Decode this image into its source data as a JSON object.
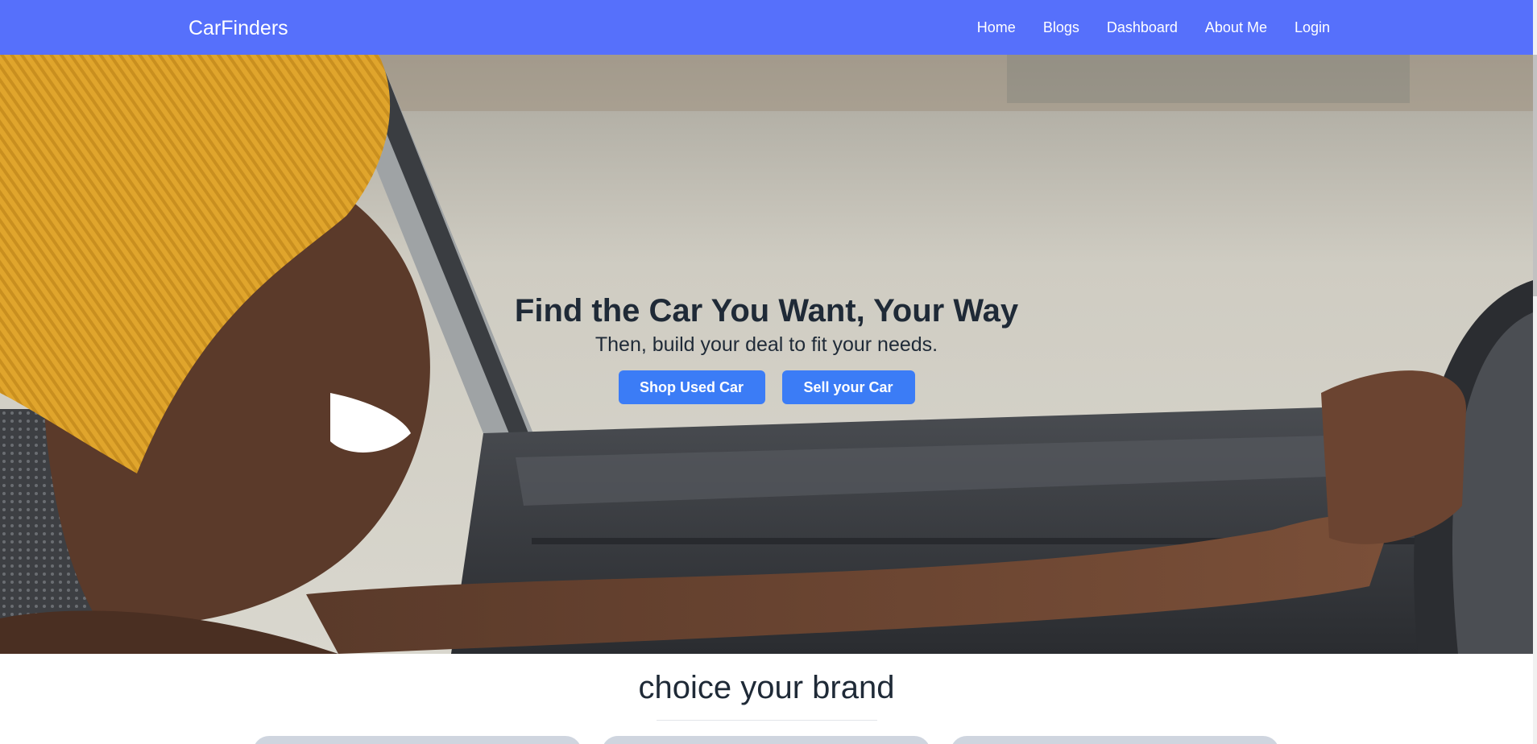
{
  "navbar": {
    "brand": "CarFinders",
    "links": [
      "Home",
      "Blogs",
      "Dashboard",
      "About Me",
      "Login"
    ]
  },
  "hero": {
    "title": "Find the Car You Want, Your Way",
    "subtitle": "Then, build your deal to fit your needs.",
    "buttons": {
      "shop": "Shop Used Car",
      "sell": "Sell your Car"
    }
  },
  "brands_section": {
    "title": "choice your brand"
  },
  "colors": {
    "navbar": "#5670fb",
    "button": "#3b7cf6",
    "text_dark": "#1f2a37"
  }
}
